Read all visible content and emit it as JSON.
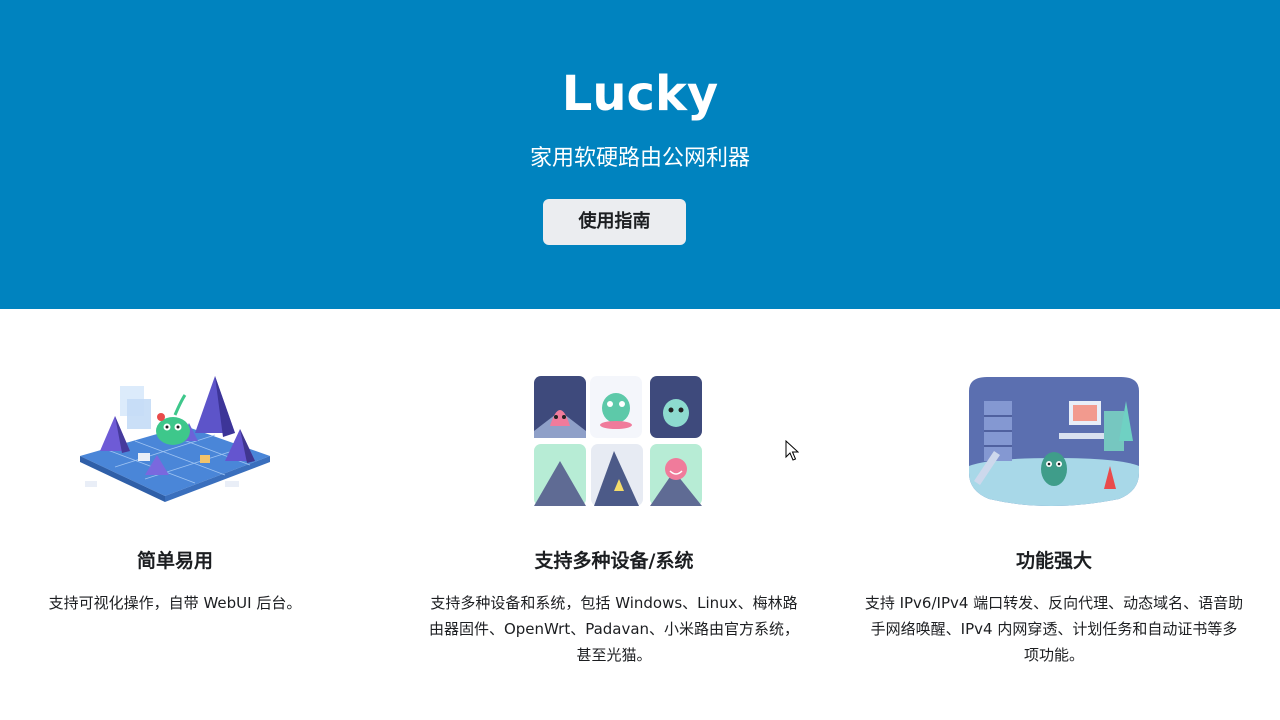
{
  "hero": {
    "title": "Lucky",
    "tagline": "家用软硬路由公网利器",
    "button_label": "使用指南",
    "background": "#0083bf"
  },
  "features": [
    {
      "title": "简单易用",
      "description": "支持可视化操作，自带 WebUI 后台。",
      "icon": "isometric-network-illustration"
    },
    {
      "title": "支持多种设备/系统",
      "description": "支持多种设备和系统，包括 Windows、Linux、梅林路由器固件、OpenWrt、Padavan、小米路由官方系统，甚至光猫。",
      "icon": "multi-device-monster-grid-illustration"
    },
    {
      "title": "功能强大",
      "description": "支持 IPv6/IPv4 端口转发、反向代理、动态域名、语音助手网络唤醒、IPv4 内网穿透、计划任务和自动证书等多项功能。",
      "icon": "monster-workshop-room-illustration"
    }
  ]
}
